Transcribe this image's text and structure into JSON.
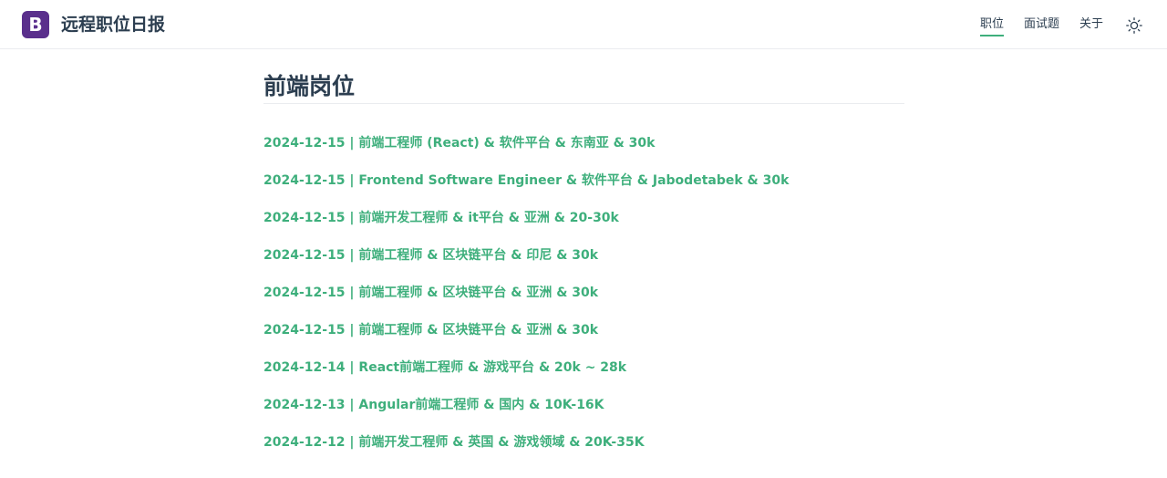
{
  "header": {
    "logo_letter": "B",
    "site_title": "远程职位日报",
    "nav": [
      {
        "label": "职位",
        "active": true
      },
      {
        "label": "面试题",
        "active": false
      },
      {
        "label": "关于",
        "active": false
      }
    ],
    "theme_icon": "sun-icon"
  },
  "main": {
    "page_title": "前端岗位",
    "jobs": [
      "2024-12-15 | 前端工程师 (React) & 软件平台 & 东南亚 & 30k",
      "2024-12-15 | Frontend Software Engineer & 软件平台 & Jabodetabek & 30k",
      "2024-12-15 | 前端开发工程师 & it平台 & 亚洲 & 20-30k",
      "2024-12-15 | 前端工程师 & 区块链平台 & 印尼 & 30k",
      "2024-12-15 | 前端工程师 & 区块链平台 & 亚洲 & 30k",
      "2024-12-15 | 前端工程师 & 区块链平台 & 亚洲 & 30k",
      "2024-12-14 | React前端工程师 & 游戏平台 & 20k ~ 28k",
      "2024-12-13 | Angular前端工程师 & 国内 & 10K-16K",
      "2024-12-12 | 前端开发工程师 & 英国 & 游戏领域 & 20K-35K"
    ]
  },
  "colors": {
    "accent": "#3eaf7c",
    "logo_bg": "#5a2f8c",
    "text": "#2c3e50"
  }
}
